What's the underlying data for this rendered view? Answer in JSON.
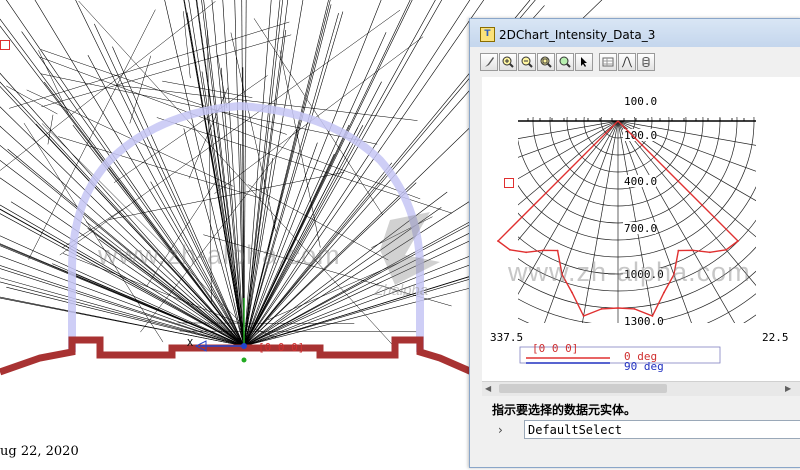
{
  "background": {
    "color": "#ffffff",
    "ray_color": "#000000",
    "dome_color": "#c6c6f5",
    "housing_color": "#a83232"
  },
  "status": {
    "date": "ug 22, 2020"
  },
  "watermark": {
    "url_left": "www.zh-alpha.com",
    "url_right": "www.zh-alpha.com",
    "brand": "Zhalpha"
  },
  "scene": {
    "coord_readout": "[0 0 0]",
    "x_axis_label": "X"
  },
  "chart_window": {
    "title": "2DChart_Intensity_Data_3",
    "toolbar": [
      {
        "icon": "paintbrush-icon"
      },
      {
        "icon": "zoom-in-icon"
      },
      {
        "icon": "zoom-out-icon"
      },
      {
        "icon": "zoom-fit-icon"
      },
      {
        "icon": "zoom-reset-icon"
      },
      {
        "icon": "pointer-icon"
      },
      {
        "icon": "table-icon"
      },
      {
        "icon": "curve-icon"
      },
      {
        "icon": "cylinder-icon"
      }
    ],
    "prompt": "指示要选择的数据元实体。",
    "command_value": "DefaultSelect"
  },
  "chart_data": {
    "type": "polar",
    "radial_ticks": [
      "100.0",
      "100.0",
      "400.0",
      "700.0",
      "1000.0",
      "1300.0"
    ],
    "radial_range": [
      100,
      1500
    ],
    "angle_labels": [
      "337.5",
      "22.5"
    ],
    "legend": [
      {
        "label": "0 deg",
        "color": "#e03030"
      },
      {
        "label": "90 deg",
        "color": "#2030c0"
      }
    ],
    "coord_text": "[0 0 0]",
    "series": [
      {
        "name": "0 deg",
        "color": "#e03030",
        "angle": [
          -45,
          -40,
          -35,
          -30,
          -25,
          -20,
          -15,
          -10,
          -5,
          0,
          5,
          10,
          15,
          20,
          25,
          30,
          35,
          40,
          45
        ],
        "values": [
          1180,
          1170,
          1120,
          1050,
          1010,
          1140,
          1230,
          1360,
          1300,
          1290,
          1300,
          1360,
          1230,
          1140,
          1010,
          1050,
          1120,
          1170,
          1180
        ]
      }
    ]
  }
}
